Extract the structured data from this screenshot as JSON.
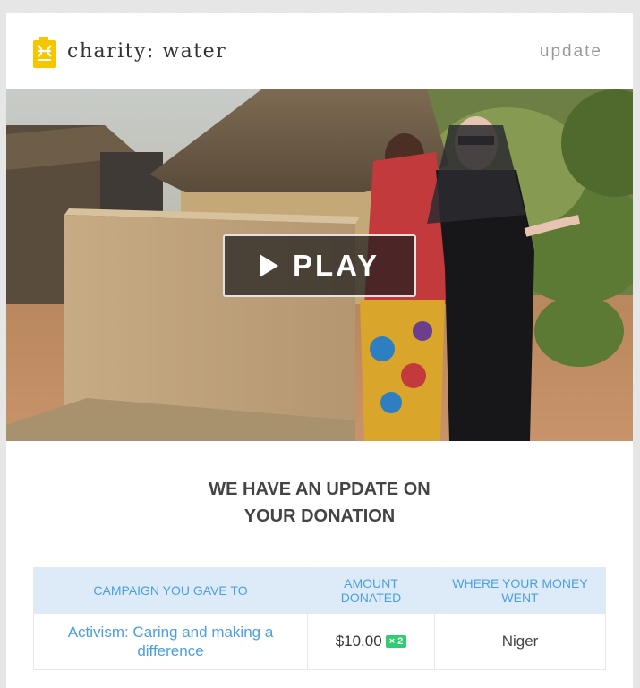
{
  "header": {
    "brand": "charity: water",
    "label": "update",
    "logo_icon": "jerry-can-icon",
    "brand_color": "#f7c600"
  },
  "video": {
    "play_label": "PLAY",
    "play_icon": "play-icon"
  },
  "headline": {
    "line1": "WE HAVE AN UPDATE ON",
    "line2": "YOUR DONATION"
  },
  "donation_table": {
    "headers": [
      "CAMPAIGN YOU GAVE TO",
      "AMOUNT DONATED",
      "WHERE YOUR MONEY WENT"
    ],
    "row": {
      "campaign": "Activism: Caring and making a difference",
      "amount": "$10.00",
      "multiplier": "× 2",
      "location": "Niger"
    },
    "header_color": "#dcebf7",
    "accent_color": "#4b9fe0",
    "badge_color": "#2fcc71"
  }
}
